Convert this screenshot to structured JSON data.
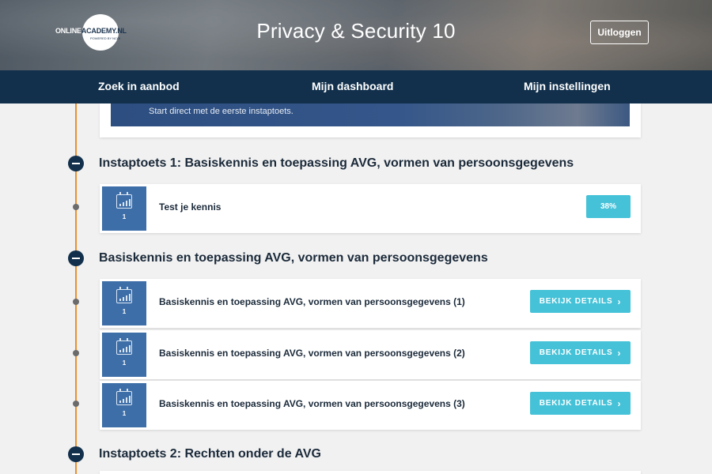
{
  "header": {
    "logo": {
      "text_left": "ONLINE",
      "text_right": "ACADEMY.NL",
      "tagline": "POWERED BY NCOI"
    },
    "title": "Privacy & Security 10",
    "logout_label": "Uitloggen"
  },
  "nav": {
    "items": [
      {
        "label": "Zoek in aanbod"
      },
      {
        "label": "Mijn dashboard"
      },
      {
        "label": "Mijn instellingen"
      }
    ]
  },
  "intro_banner": {
    "text": "Start direct met de eerste instaptoets."
  },
  "sections": [
    {
      "title": "Instaptoets 1: Basiskennis en toepassing AVG, vormen van persoonsgegevens",
      "items": [
        {
          "icon": "calendar-chart-icon",
          "icon_number": "1",
          "title": "Test je kennis",
          "progress": "38%"
        }
      ]
    },
    {
      "title": "Basiskennis en toepassing AVG, vormen van persoonsgegevens",
      "items": [
        {
          "icon": "calendar-chart-icon",
          "icon_number": "1",
          "title": "Basiskennis en toepassing AVG, vormen van persoonsgegevens (1)",
          "button": "BEKIJK DETAILS"
        },
        {
          "icon": "calendar-chart-icon",
          "icon_number": "1",
          "title": "Basiskennis en toepassing AVG, vormen van persoonsgegevens (2)",
          "button": "BEKIJK DETAILS"
        },
        {
          "icon": "calendar-chart-icon",
          "icon_number": "1",
          "title": "Basiskennis en toepassing AVG, vormen van persoonsgegevens (3)",
          "button": "BEKIJK DETAILS"
        }
      ]
    },
    {
      "title": "Instaptoets 2: Rechten onder de AVG",
      "items": []
    }
  ],
  "colors": {
    "nav_bg": "#12304c",
    "timeline": "#e8912d",
    "accent_button": "#45c2d8",
    "icon_tile": "#3d6ea8",
    "page_bg": "#f1f1f1"
  }
}
